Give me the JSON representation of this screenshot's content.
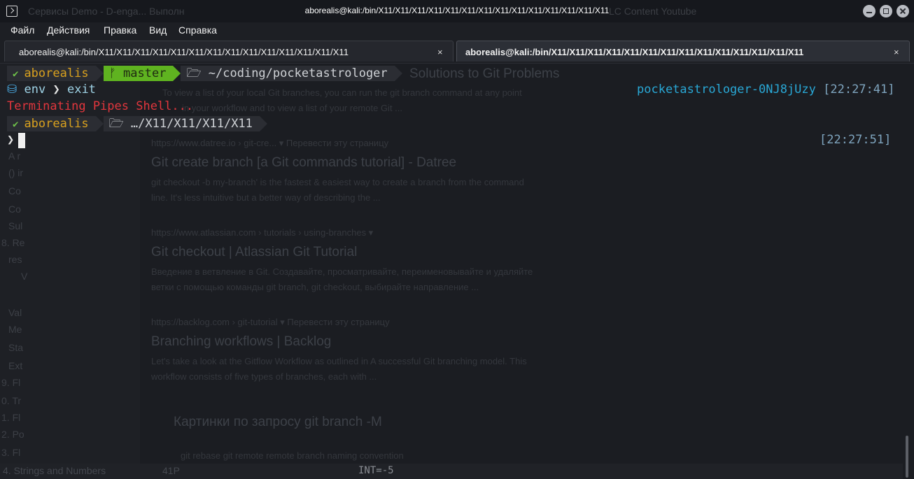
{
  "window": {
    "title": "aborealis@kali:/bin/X11/X11/X11/X11/X11/X11/X11/X11/X11/X11/X11/X11/X11/X11",
    "background_bookmarks": "Сервисы    Demo - D-enga...    Выполн"
  },
  "menu": {
    "items": [
      "Файл",
      "Действия",
      "Правка",
      "Вид",
      "Справка"
    ]
  },
  "tabs": [
    {
      "label": "aborealis@kali:/bin/X11/X11/X11/X11/X11/X11/X11/X11/X11/X11/X11/X11/X11/X11",
      "close": "×",
      "active": false
    },
    {
      "label": "aborealis@kali:/bin/X11/X11/X11/X11/X11/X11/X11/X11/X11/X11/X11/X11/X11/X11",
      "close": "×",
      "active": true
    }
  ],
  "prompt1": {
    "user": "aborealis",
    "branch_icon": "ᚠ",
    "branch": "master",
    "folder_icon": "🗁",
    "path": "~/coding/pocketastrologer"
  },
  "line2": {
    "env_icon": "⛁",
    "env": "env",
    "arrow": "❯",
    "command": "exit",
    "right_env": "pocketastrologer-0NJ8jUzy",
    "right_time": "[22:27:41]"
  },
  "line3": {
    "message": "Terminating Pipes Shell..."
  },
  "prompt2": {
    "user": "aborealis",
    "folder_icon": "🗁",
    "path": "…/X11/X11/X11/X11"
  },
  "line5": {
    "arrow": "❯",
    "right_time": "[22:27:51]"
  },
  "background_page": {
    "heading": "Solutions to Git Problems",
    "snippet1": "To view a list of your local Git branches, you can run the git branch command at any point",
    "snippet1b": "in your workflow and to view a list of your remote Git ...",
    "url2": "https://www.datree.io › git-cre...  ▾  Перевести эту страницу",
    "title2": "Git create branch [a Git commands tutorial] - Datree",
    "snippet2": "git checkout -b my-branch' is the fastest & easiest way to create a branch from the command",
    "snippet2b": "line. It's less intuitive but a better way of describing the ...",
    "url3": "https://www.atlassian.com › tutorials › using-branches  ▾",
    "title3": "Git checkout | Atlassian Git Tutorial",
    "snippet3": "Введение в ветвление в Git. Создавайте, просматривайте, переименовывайте и удаляйте",
    "snippet3b": "ветки с помощью команды git branch, git checkout, выбирайте направление ...",
    "url4": "https://backlog.com › git-tutorial  ▾  Перевести эту страницу",
    "title4": "Branching workflows | Backlog",
    "snippet4": "Let's take a look at the Gitflow Workflow as outlined in A successful Git branching model. This",
    "snippet4b": "workflow consists of five types of branches, each with ...",
    "images_heading": "Картинки по запросу git branch -M",
    "chips": "git rebase      git remote      remote branch      naming convention",
    "sidebar": [
      "A r",
      "() ir",
      "Co",
      "Co",
      "Sul",
      "8. Re",
      "res",
      "V",
      "Val",
      "Me",
      "Sta",
      "Ext",
      "9. Fl",
      "0. Tr",
      "1. Fl",
      "2. Po",
      "3. Fl"
    ],
    "bottom_left": "4. Strings and Numbers",
    "bottom_mid": "41P",
    "bottom_code": "INT=-5",
    "bookmarks_right": "LC      Content      Youtube"
  }
}
